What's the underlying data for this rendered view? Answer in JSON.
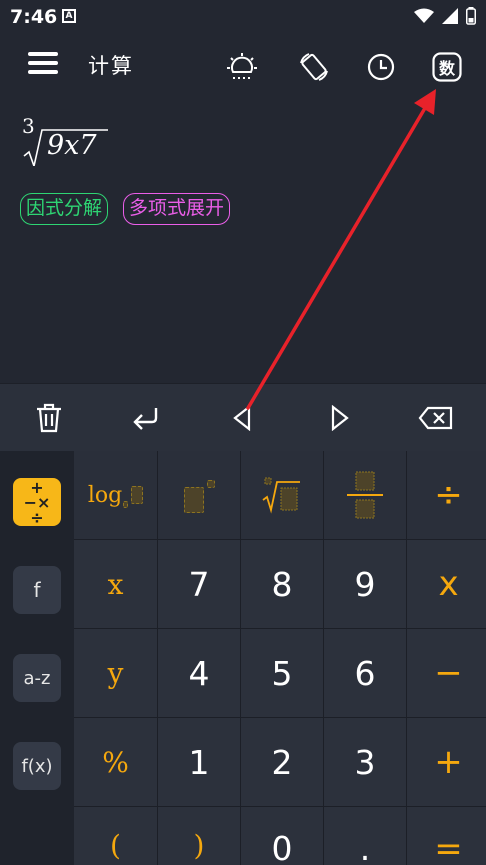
{
  "status_bar": {
    "time": "7:46",
    "notification_icon": "A",
    "icons": [
      "wifi-icon",
      "signal-icon",
      "battery-icon"
    ]
  },
  "header": {
    "title": "计算",
    "buttons": [
      "menu-icon",
      "brightness-icon",
      "rotate-screen-icon",
      "history-clock-icon",
      "number-mode-icon"
    ],
    "number_mode_label": "数"
  },
  "expression": {
    "root_index": "3",
    "radicand": "9x7"
  },
  "suggestions": [
    {
      "label": "因式分解",
      "color": "#2ed573"
    },
    {
      "label": "多项式展开",
      "color": "#ea5ee8"
    }
  ],
  "toolbar": [
    "trash-icon",
    "enter-icon",
    "cursor-left-icon",
    "cursor-right-icon",
    "backspace-icon"
  ],
  "sidebar": [
    {
      "label": "+−×÷",
      "active": true
    },
    {
      "label": "f",
      "active": false
    },
    {
      "label": "a-z",
      "active": false
    },
    {
      "label": "f(x)",
      "active": false
    }
  ],
  "keys": {
    "log": "log",
    "row2": [
      "x",
      "7",
      "8",
      "9",
      "x"
    ],
    "row3": [
      "y",
      "4",
      "5",
      "6",
      "−"
    ],
    "row4": [
      "%",
      "1",
      "2",
      "3",
      "+"
    ],
    "row5": [
      "(",
      ")",
      "0",
      ".",
      "="
    ],
    "divide": "÷"
  },
  "colors": {
    "accent": "#f5a80e",
    "background": "#232731",
    "annotation_arrow": "#e8222a"
  }
}
